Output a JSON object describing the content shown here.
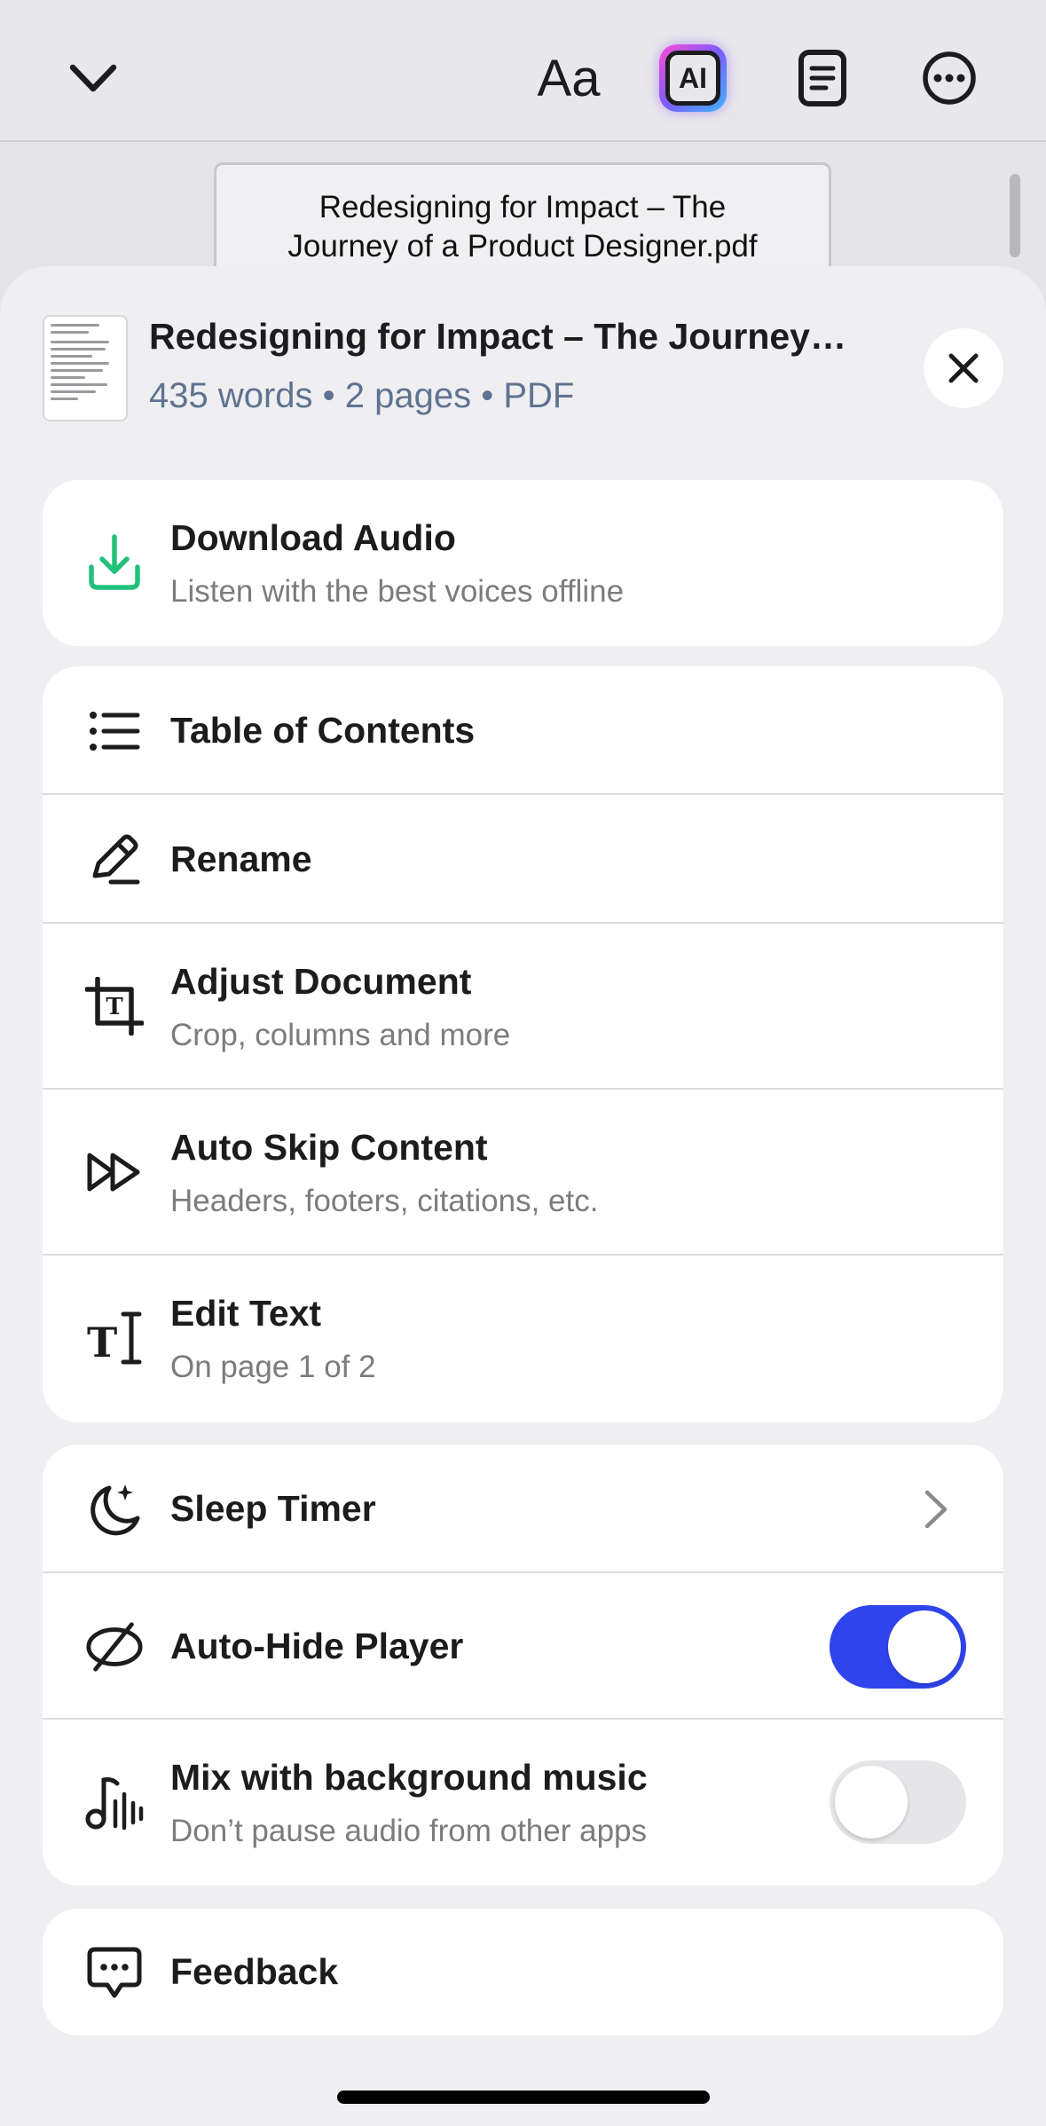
{
  "topbar": {
    "collapse_icon": "chevron-down-icon",
    "font_label": "Aa",
    "ai_label": "AI",
    "ai_gradient": [
      "#ff4bd0",
      "#7a5cff",
      "#3fb6ff"
    ],
    "document_icon": "document-icon",
    "more_icon": "ellipsis-circle-icon"
  },
  "background_doc": {
    "line1": "Redesigning for Impact – The",
    "line2": "Journey of a Product Designer.pdf"
  },
  "sheet": {
    "title": "Redesigning for Impact – The Journey…",
    "meta": "435 words • 2 pages • PDF",
    "close_icon": "close-icon"
  },
  "download": {
    "title": "Download Audio",
    "subtitle": "Listen with the best voices offline",
    "icon": "download-icon",
    "icon_color": "#22c17a"
  },
  "menu": {
    "toc": {
      "title": "Table of Contents",
      "icon": "list-icon"
    },
    "rename": {
      "title": "Rename",
      "icon": "pencil-icon"
    },
    "adjust": {
      "title": "Adjust Document",
      "subtitle": "Crop, columns and more",
      "icon": "crop-icon"
    },
    "skip": {
      "title": "Auto Skip Content",
      "subtitle": "Headers, footers, citations, etc.",
      "icon": "fast-forward-icon"
    },
    "edit": {
      "title": "Edit Text",
      "subtitle": "On page 1 of 2",
      "icon": "text-cursor-icon"
    }
  },
  "settings": {
    "sleep": {
      "title": "Sleep Timer",
      "icon": "moon-stars-icon"
    },
    "autohide": {
      "title": "Auto-Hide Player",
      "icon": "eye-slash-icon",
      "enabled": true
    },
    "mix": {
      "title": "Mix with background music",
      "subtitle": "Don’t pause audio from other apps",
      "icon": "music-note-icon",
      "enabled": false
    },
    "toggle_on_color": "#2f44ec"
  },
  "feedback": {
    "title": "Feedback",
    "icon": "chat-bubble-icon"
  }
}
